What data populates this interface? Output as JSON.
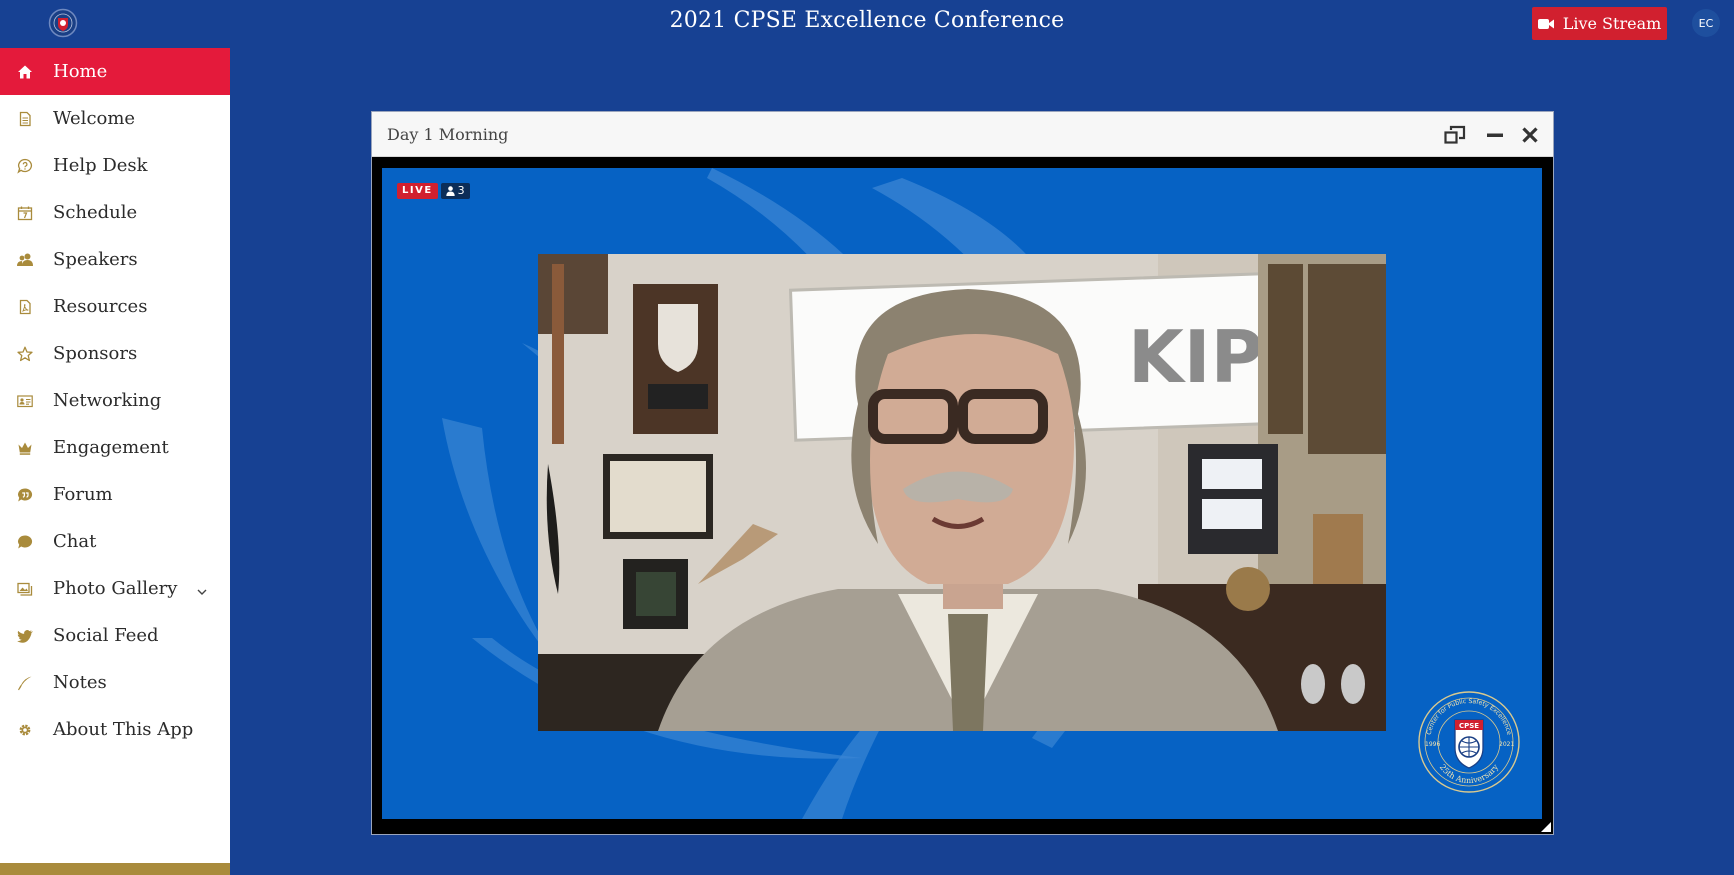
{
  "header": {
    "title": "2021 CPSE Excellence Conference",
    "live_stream_label": "Live Stream",
    "avatar_initials": "EC"
  },
  "sidebar": {
    "items": [
      {
        "label": "Home",
        "icon": "home-icon",
        "active": true
      },
      {
        "label": "Welcome",
        "icon": "document-icon"
      },
      {
        "label": "Help Desk",
        "icon": "help-bubble-icon"
      },
      {
        "label": "Schedule",
        "icon": "calendar-icon"
      },
      {
        "label": "Speakers",
        "icon": "users-icon"
      },
      {
        "label": "Resources",
        "icon": "pdf-file-icon"
      },
      {
        "label": "Sponsors",
        "icon": "star-icon"
      },
      {
        "label": "Networking",
        "icon": "id-card-icon"
      },
      {
        "label": "Engagement",
        "icon": "crown-icon"
      },
      {
        "label": "Forum",
        "icon": "quote-bubble-icon"
      },
      {
        "label": "Chat",
        "icon": "chat-bubble-icon"
      },
      {
        "label": "Photo Gallery",
        "icon": "gallery-icon",
        "has_submenu": true
      },
      {
        "label": "Social Feed",
        "icon": "twitter-icon"
      },
      {
        "label": "Notes",
        "icon": "pencil-icon"
      },
      {
        "label": "About This App",
        "icon": "gear-icon"
      }
    ]
  },
  "window": {
    "title": "Day 1 Morning",
    "live_label": "LIVE",
    "viewer_count": "3"
  },
  "video": {
    "sign_text": "KIPOL"
  },
  "seal": {
    "ring_text": "Center for Public Safety Excellence",
    "badge_text": "CPSE",
    "year_start": "1996",
    "year_end": "2021",
    "anniversary": "25th Anniversary"
  },
  "colors": {
    "brand_blue": "#174193",
    "video_blue": "#0662c4",
    "active_red": "#e41a3b",
    "live_red": "#d1202f",
    "accent_gold": "#a98b3c"
  }
}
